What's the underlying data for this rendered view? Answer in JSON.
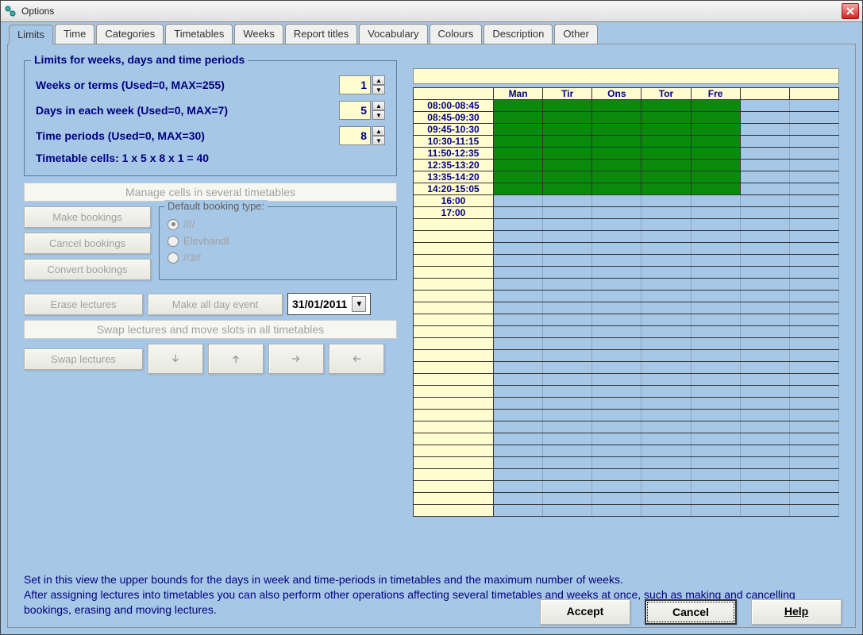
{
  "window": {
    "title": "Options"
  },
  "tabs": [
    "Limits",
    "Time",
    "Categories",
    "Timetables",
    "Weeks",
    "Report titles",
    "Vocabulary",
    "Colours",
    "Description",
    "Other"
  ],
  "limits": {
    "legend": "Limits for weeks, days and time periods",
    "weeks": {
      "label": "Weeks or terms (Used=0, MAX=255)",
      "value": "1"
    },
    "days": {
      "label": "Days in each week (Used=0, MAX=7)",
      "value": "5"
    },
    "periods": {
      "label": "Time periods (Used=0, MAX=30)",
      "value": "8"
    },
    "calc": "Timetable cells: 1 x 5 x 8 x 1 = 40"
  },
  "sections": {
    "manage": "Manage cells in several timetables",
    "swap": "Swap lectures and move slots in all timetables"
  },
  "buttons": {
    "make_bookings": "Make bookings",
    "cancel_bookings": "Cancel bookings",
    "convert_bookings": "Convert bookings",
    "erase_lectures": "Erase lectures",
    "make_allday": "Make all day event",
    "swap_lectures": "Swap lectures"
  },
  "booking_type": {
    "legend": "Default booking type:",
    "options": [
      "////",
      "Elevhandl.",
      "//3//"
    ],
    "selected": 0
  },
  "date": {
    "value": "31/01/2011"
  },
  "days_header": [
    "Man",
    "Tir",
    "Ons",
    "Tor",
    "Fre",
    "",
    ""
  ],
  "timeslots": [
    "08:00-08:45",
    "08:45-09:30",
    "09:45-10:30",
    "10:30-11:15",
    "11:50-12:35",
    "12:35-13:20",
    "13:35-14:20",
    "14:20-15:05",
    "16:00",
    "17:00"
  ],
  "green_rows": 8,
  "help": {
    "line1": "Set in this view the upper bounds for the days in week and time-periods in timetables and the maximum number of weeks.",
    "line2": "After assigning lectures into timetables you can also perform other operations affecting several timetables and weeks at once, such as making and cancelling bookings, erasing and moving lectures."
  },
  "footer": {
    "accept": "Accept",
    "cancel": "Cancel",
    "help": "Help"
  }
}
